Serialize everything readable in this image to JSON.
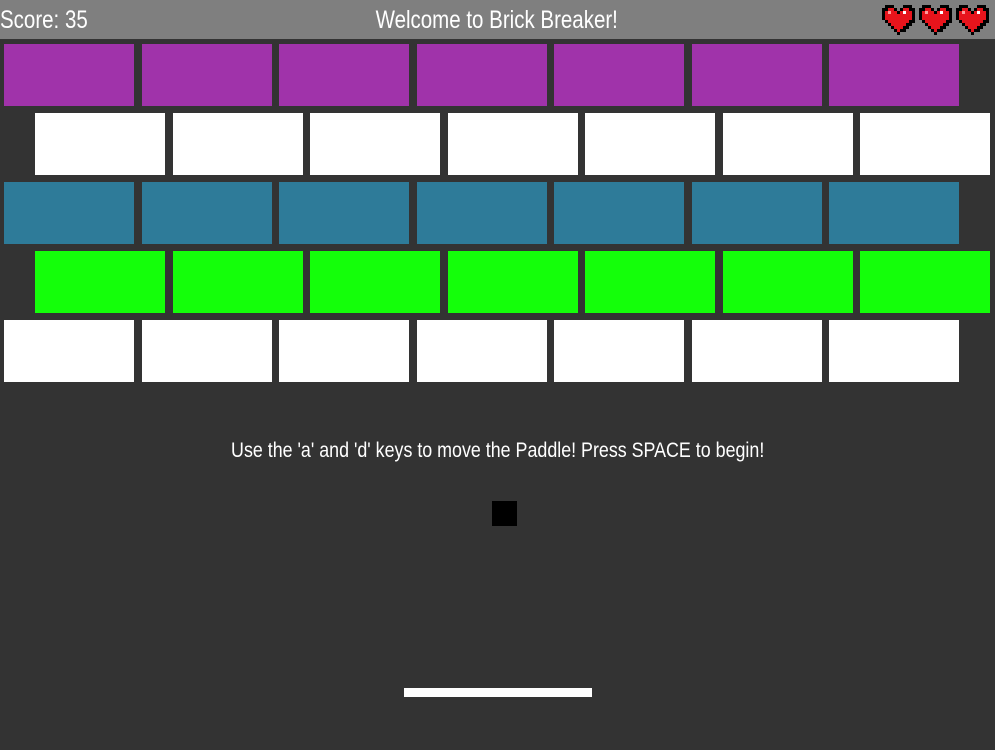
{
  "hud": {
    "score_text": "Score: 35",
    "title": "Welcome to Brick Breaker!",
    "lives": 3,
    "heart_icon": "pixel-heart-icon",
    "bar_color": "#7f7f7f"
  },
  "message": "Use the 'a' and 'd' keys to move the Paddle! Press SPACE to begin!",
  "colors": {
    "background": "#333333",
    "ball": "#000000",
    "paddle": "#ffffff",
    "heart": "#e8141c"
  },
  "brick_rows": [
    {
      "color": "#a033aa",
      "count": 7
    },
    {
      "color": "#ffffff",
      "count": 7
    },
    {
      "color": "#2e7b99",
      "count": 7
    },
    {
      "color": "#14ff0a",
      "count": 7
    },
    {
      "color": "#ffffff",
      "count": 7
    }
  ]
}
